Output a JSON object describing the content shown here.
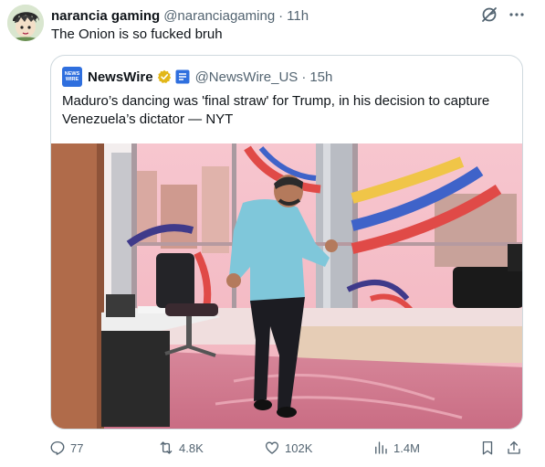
{
  "tweet": {
    "author_name": "narancia gaming",
    "author_handle": "@naranciagaming",
    "separator": "·",
    "time": "11h",
    "text": "The Onion is so fucked bruh"
  },
  "quote": {
    "avatar_text_1": "NEWS",
    "avatar_text_2": "WIRE",
    "author_name": "NewsWire",
    "author_handle": "@NewsWire_US",
    "separator": "·",
    "time": "15h",
    "text": "Maduro’s dancing was 'final straw' for Trump, in his decision to capture Venezuela’s dictator — NYT",
    "media_icon": "news-photo"
  },
  "actions": {
    "replies": "77",
    "reposts": "4.8K",
    "likes": "102K",
    "views": "1.4M"
  },
  "colors": {
    "text": "#0f1419",
    "secondary": "#536471",
    "border": "#cfd9de",
    "verified_gold": "#e2b719",
    "org_blue": "#2f6fde"
  },
  "icons": [
    "grok-icon",
    "more-icon",
    "verified-badge-icon",
    "org-affiliate-icon",
    "reply-icon",
    "repost-icon",
    "like-icon",
    "views-icon",
    "bookmark-icon",
    "share-icon"
  ]
}
